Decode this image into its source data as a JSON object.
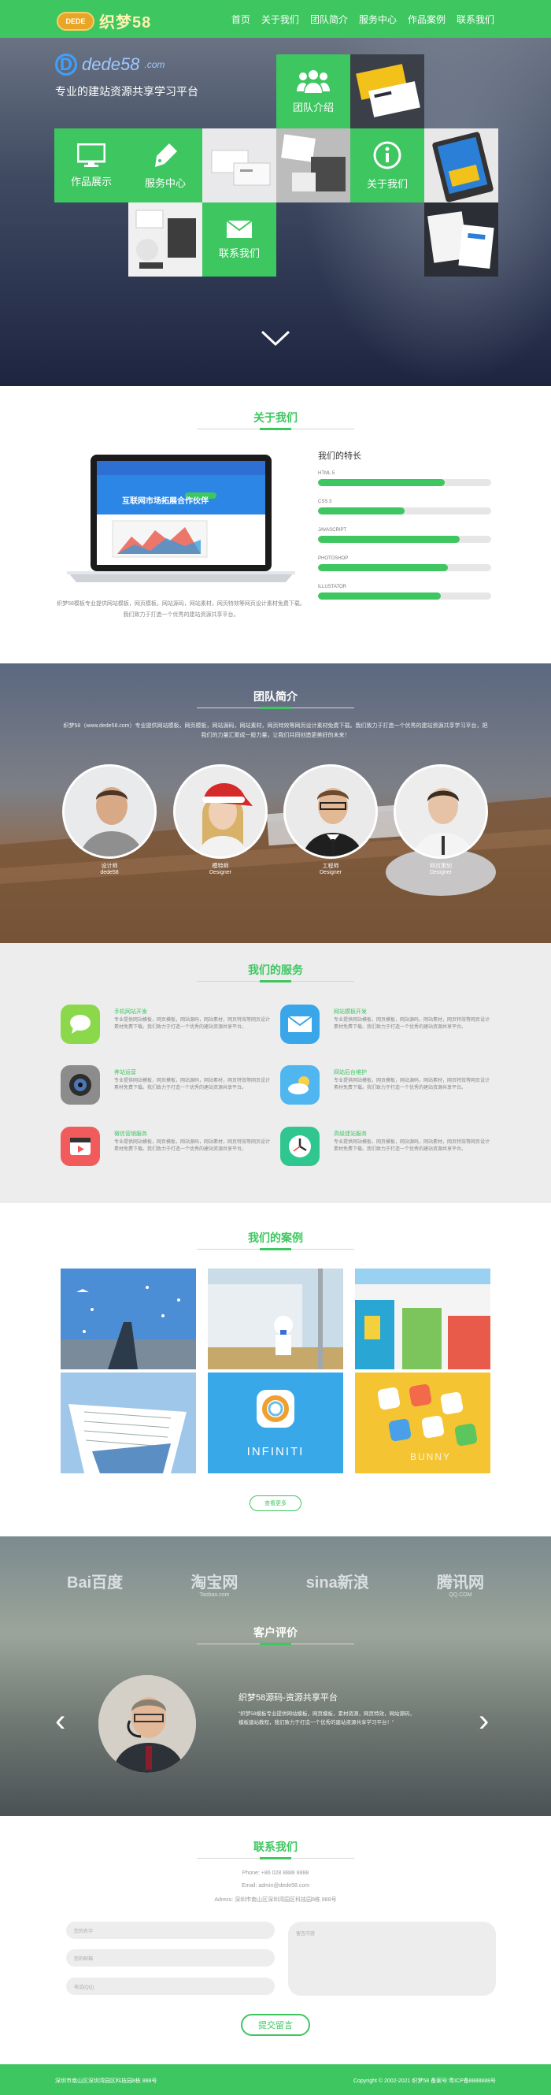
{
  "nav": {
    "logo_badge": "DEDE",
    "logo_text": "织梦58",
    "items": [
      "首页",
      "关于我们",
      "团队简介",
      "服务中心",
      "作品案例",
      "联系我们"
    ]
  },
  "hero": {
    "brand_name": "dede58",
    "brand_suffix": ".com",
    "tagline": "专业的建站资源共享学习平台",
    "tiles": {
      "team": "团队介绍",
      "works": "作品展示",
      "service": "服务中心",
      "about": "关于我们",
      "contact": "联系我们"
    }
  },
  "about": {
    "title": "关于我们",
    "laptop_screen_title": "互联网市场拓展合作伙伴",
    "skills_title": "我们的特长",
    "skills": [
      {
        "label": "HTML 5",
        "value": 0.73
      },
      {
        "label": "CSS 3",
        "value": 0.5
      },
      {
        "label": "JAVASCRIPT",
        "value": 0.82
      },
      {
        "label": "PHOTOSHOP",
        "value": 0.75
      },
      {
        "label": "ILLUSTATOR",
        "value": 0.71
      }
    ],
    "text": "织梦58模板专业提供网站模板，网页模板，网站源码，网站素材，网页特效等网页设计素材免费下载。我们致力于打造一个优秀的建站资源共享平台。"
  },
  "team": {
    "title": "团队简介",
    "desc": "织梦58（www.dede58.com）专业提供网站模板，网页模板，网站源码，网站素材，网页特效等网页设计素材免费下载。我们致力于打造一个优秀的建站资源共享学习平台，把我们的力量汇聚成一股力量，让我们共同创造更美好的未来！",
    "members": [
      {
        "name": "设计师",
        "role": "dede58"
      },
      {
        "name": "模特师",
        "role": "Designer"
      },
      {
        "name": "工程师",
        "role": "Designer"
      },
      {
        "name": "网页策划",
        "role": "Designer"
      }
    ]
  },
  "services": {
    "title": "我们的服务",
    "items": [
      {
        "title": "手机网站开发",
        "desc": "专业提供网站模板，网页模板，网站源码，网站素材，网页特效等网页设计素材免费下载。我们致力于打造一个优秀的建站资源共享平台。",
        "icon": "chat-icon",
        "color": "#8bd94a"
      },
      {
        "title": "网站模板开发",
        "desc": "专业提供网站模板，网页模板，网站源码，网站素材，网页特效等网页设计素材免费下载。我们致力于打造一个优秀的建站资源共享平台。",
        "icon": "mail-icon",
        "color": "#3aa6ea"
      },
      {
        "title": "养站运营",
        "desc": "专业提供网站模板，网页模板，网站源码，网站素材，网页特效等网页设计素材免费下载。我们致力于打造一个优秀的建站资源共享平台。",
        "icon": "camera-icon",
        "color": "#8c8c8c"
      },
      {
        "title": "网站后台维护",
        "desc": "专业提供网站模板，网页模板，网站源码，网站素材，网页特效等网页设计素材免费下载。我们致力于打造一个优秀的建站资源共享平台。",
        "icon": "weather-icon",
        "color": "#4fb6f0"
      },
      {
        "title": "微信营销服务",
        "desc": "专业提供网站模板，网页模板，网站源码，网站素材，网页特效等网页设计素材免费下载。我们致力于打造一个优秀的建站资源共享平台。",
        "icon": "video-icon",
        "color": "#f25b5b"
      },
      {
        "title": "高级建站服务",
        "desc": "专业提供网站模板，网页模板，网站源码，网站素材，网页特效等网页设计素材免费下载。我们致力于打造一个优秀的建站资源共享平台。",
        "icon": "clock-icon",
        "color": "#2fc78f"
      }
    ]
  },
  "cases": {
    "title": "我们的案例",
    "more": "查看更多",
    "infiniti_label": "INFINITI",
    "bunny_label": "BUNNY"
  },
  "testimonials": {
    "title": "客户评价",
    "partners": [
      "Bai百度",
      "淘宝网",
      "sina新浪",
      "腾讯网"
    ],
    "partner_subs": [
      "",
      "Taobao.com",
      "",
      "QQ.COM"
    ],
    "name": "织梦58源码-资源共享平台",
    "text": "\"织梦58模板专业提供网站模板，网页模板，素材资源，网页特效，网站源码，模板建站教程，我们致力于打造一个优秀的建站资源共享学习平台！\""
  },
  "contact": {
    "title": "联系我们",
    "phone": "Phone: +86 028 8888 8888",
    "email": "Email: admin@dede58.com",
    "address": "Adress: 深圳市南山区深圳湾园区科技园8栋 888号",
    "name_placeholder": "您的名字",
    "email_placeholder": "您的邮箱",
    "phone_placeholder": "电话(QQ)",
    "message_placeholder": "留言内容",
    "submit": "提交留言"
  },
  "footer": {
    "left": "深圳市南山区深圳湾园区科技园8栋 888号",
    "right": "Copyright © 2002-2021 织梦58 备案号:粤ICP备8888888号"
  }
}
